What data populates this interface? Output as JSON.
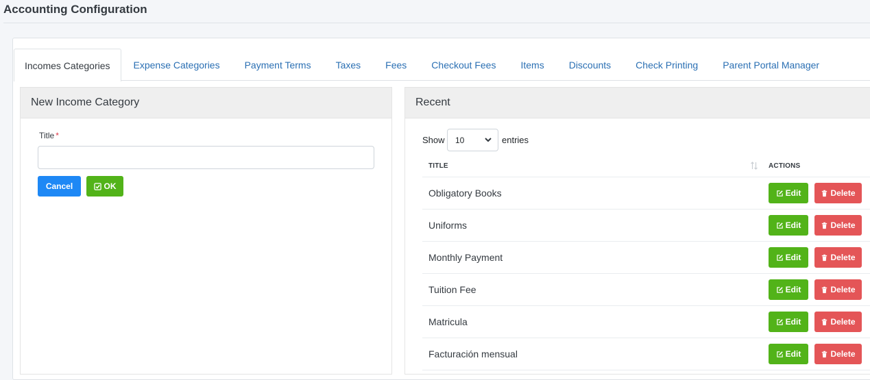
{
  "page": {
    "title": "Accounting Configuration"
  },
  "tabs": [
    {
      "label": "Incomes Categories",
      "active": true
    },
    {
      "label": "Expense Categories"
    },
    {
      "label": "Payment Terms"
    },
    {
      "label": "Taxes"
    },
    {
      "label": "Fees"
    },
    {
      "label": "Checkout Fees"
    },
    {
      "label": "Items"
    },
    {
      "label": "Discounts"
    },
    {
      "label": "Check Printing"
    },
    {
      "label": "Parent Portal Manager"
    }
  ],
  "form": {
    "header": "New Income Category",
    "title_label": "Title",
    "required_mark": "*",
    "title_value": "",
    "title_placeholder": "",
    "cancel_label": "Cancel",
    "ok_label": "OK"
  },
  "recent": {
    "header": "Recent",
    "show_label": "Show",
    "entries_value": "10",
    "entries_label": "entries",
    "col_title": "TITLE",
    "col_actions": "ACTIONS",
    "edit_label": "Edit",
    "delete_label": "Delete",
    "rows": [
      {
        "title": "Obligatory Books"
      },
      {
        "title": "Uniforms"
      },
      {
        "title": "Monthly Payment"
      },
      {
        "title": "Tuition Fee"
      },
      {
        "title": "Matricula"
      },
      {
        "title": "Facturación mensual"
      }
    ]
  },
  "colors": {
    "primary": "#1e88f5",
    "success": "#52b319",
    "danger": "#e45557",
    "link": "#2a6fb3"
  },
  "icons": {
    "ok": "check-square-icon",
    "edit": "pencil-square-icon",
    "delete": "trash-icon",
    "sort": "sort-icon",
    "select": "chevron-down-icon"
  }
}
